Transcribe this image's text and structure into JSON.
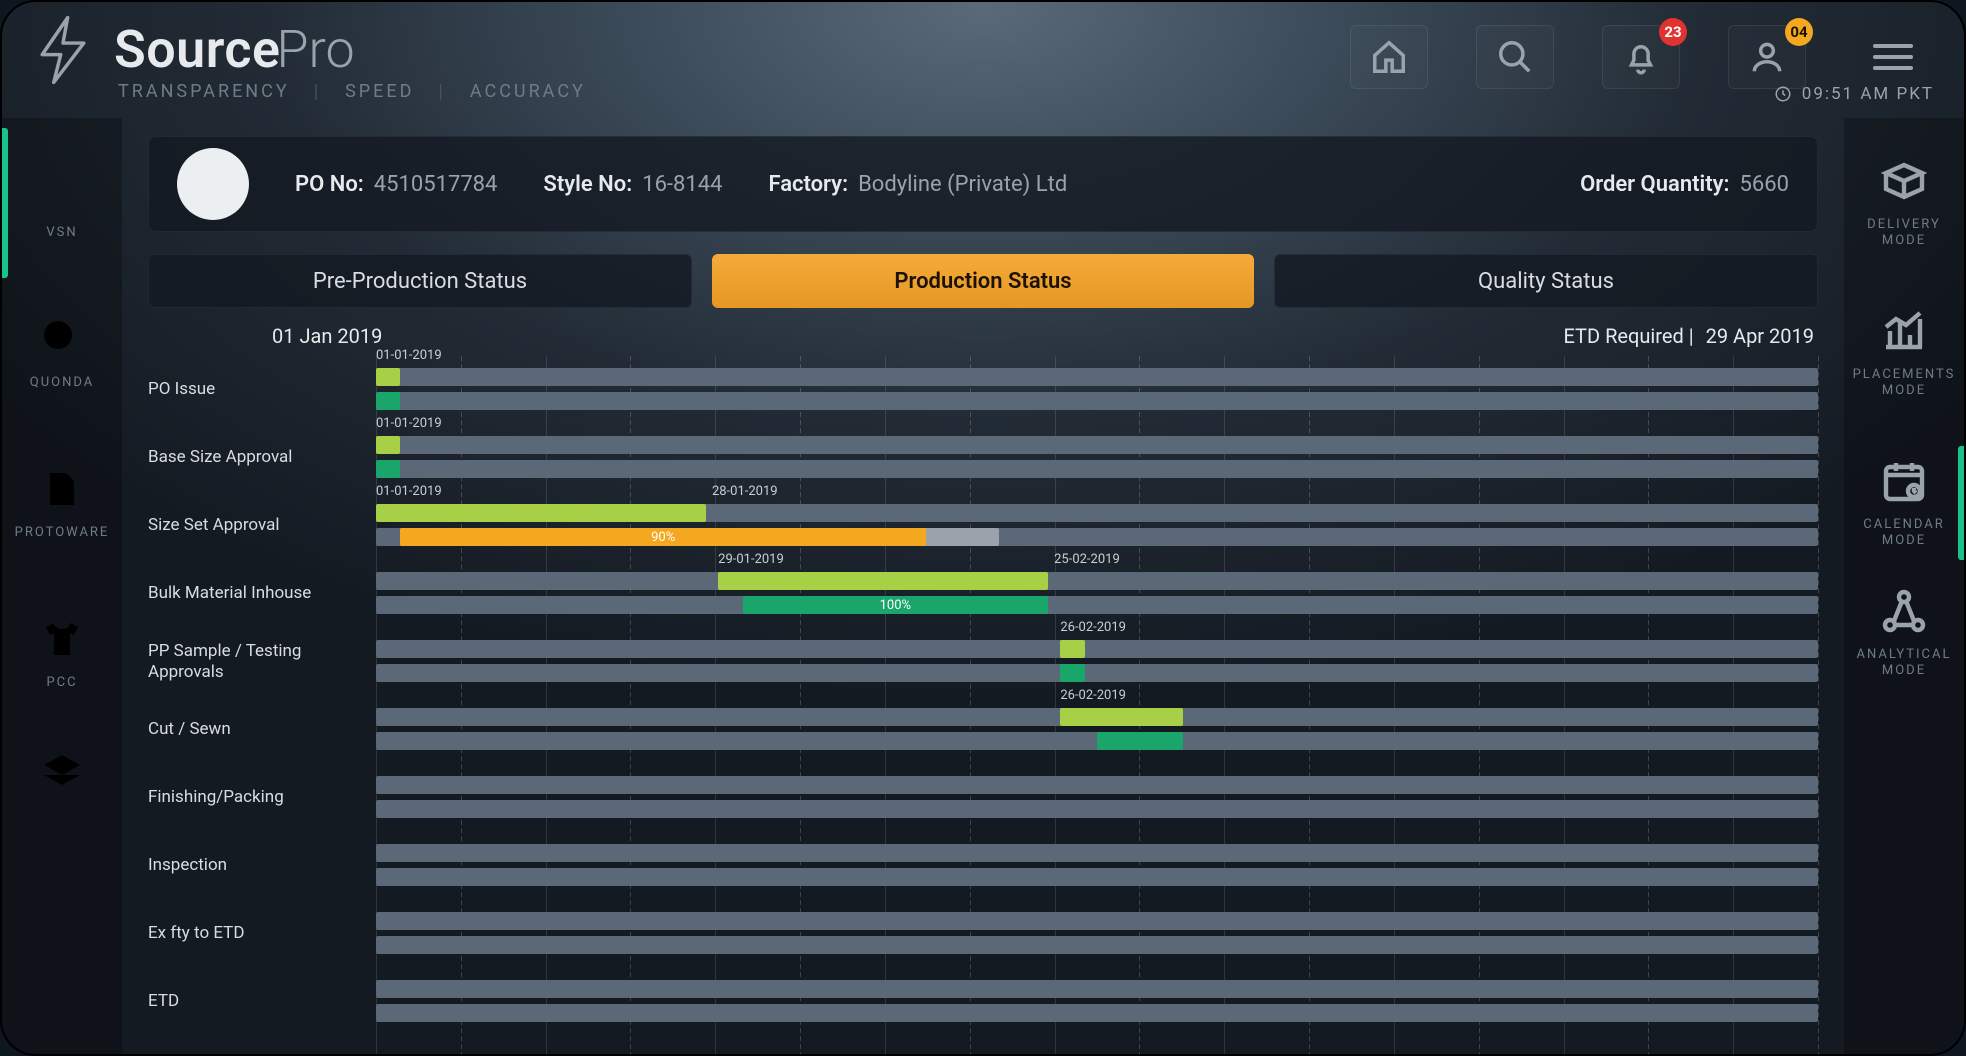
{
  "brand": {
    "main": "Source",
    "sub": "Pro"
  },
  "tagline": [
    "TRANSPARENCY",
    "SPEED",
    "ACCURACY"
  ],
  "header": {
    "notifications_count": "23",
    "profile_count": "04",
    "time": "09:51 AM PKT"
  },
  "left_sidebar": [
    {
      "id": "vsn",
      "label": "VSN"
    },
    {
      "id": "quonda",
      "label": "QUONDA"
    },
    {
      "id": "protoware",
      "label": "PROTOWARE"
    },
    {
      "id": "pcc",
      "label": "PCC"
    }
  ],
  "right_sidebar": [
    {
      "id": "delivery",
      "label": "DELIVERY\nMODE"
    },
    {
      "id": "placements",
      "label": "PLACEMENTS\nMODE"
    },
    {
      "id": "calendar",
      "label": "CALENDAR\nMODE",
      "active": true
    },
    {
      "id": "analytical",
      "label": "ANALYTICAL\nMODE"
    }
  ],
  "info": {
    "po_no_label": "PO No:",
    "po_no": "4510517784",
    "style_no_label": "Style No:",
    "style_no": "16-8144",
    "factory_label": "Factory:",
    "factory": "Bodyline (Private) Ltd",
    "order_qty_label": "Order Quantity:",
    "order_qty": "5660"
  },
  "tabs": [
    {
      "label": "Pre-Production Status",
      "active": false
    },
    {
      "label": "Production Status",
      "active": true
    },
    {
      "label": "Quality Status",
      "active": false
    }
  ],
  "gantt": {
    "start_label": "01 Jan 2019",
    "etd_label": "ETD Required |",
    "etd_value": "29 Apr 2019"
  },
  "chart_data": {
    "type": "bar",
    "title": "Production Status",
    "x_unit": "date",
    "x_range": [
      "2019-01-01",
      "2019-04-29"
    ],
    "tasks": [
      {
        "name": "PO Issue",
        "plan": {
          "start": "2019-01-01",
          "end": "2019-01-03",
          "label": "01-01-2019"
        },
        "actual": {
          "start": "2019-01-01",
          "end": "2019-01-03"
        }
      },
      {
        "name": "Base Size Approval",
        "plan": {
          "start": "2019-01-01",
          "end": "2019-01-03",
          "label": "01-01-2019"
        },
        "actual": {
          "start": "2019-01-01",
          "end": "2019-01-03"
        }
      },
      {
        "name": "Size Set Approval",
        "plan": {
          "start": "2019-01-01",
          "end": "2019-01-28",
          "label_left": "01-01-2019",
          "label_right": "28-01-2019"
        },
        "actual": {
          "start": "2019-01-03",
          "end": "2019-02-21",
          "progress_pct": 90,
          "progress_end": "2019-02-15"
        }
      },
      {
        "name": "Bulk Material Inhouse",
        "plan": {
          "start": "2019-01-29",
          "end": "2019-02-25",
          "label_left": "29-01-2019",
          "label_right": "25-02-2019"
        },
        "actual": {
          "start": "2019-01-31",
          "end": "2019-02-25",
          "progress_pct": 100
        }
      },
      {
        "name": "PP Sample / Testing Approvals",
        "plan": {
          "start": "2019-02-26",
          "end": "2019-02-28",
          "label": "26-02-2019"
        },
        "actual": {
          "start": "2019-02-26",
          "end": "2019-02-28"
        }
      },
      {
        "name": "Cut / Sewn",
        "plan": {
          "start": "2019-02-26",
          "end": "2019-03-08",
          "label": "26-02-2019"
        },
        "actual": {
          "start": "2019-03-01",
          "end": "2019-03-08"
        }
      },
      {
        "name": "Finishing/Packing",
        "plan": null,
        "actual": null
      },
      {
        "name": "Inspection",
        "plan": null,
        "actual": null
      },
      {
        "name": "Ex fty to ETD",
        "plan": null,
        "actual": null
      },
      {
        "name": "ETD",
        "plan": null,
        "actual": null
      }
    ]
  }
}
